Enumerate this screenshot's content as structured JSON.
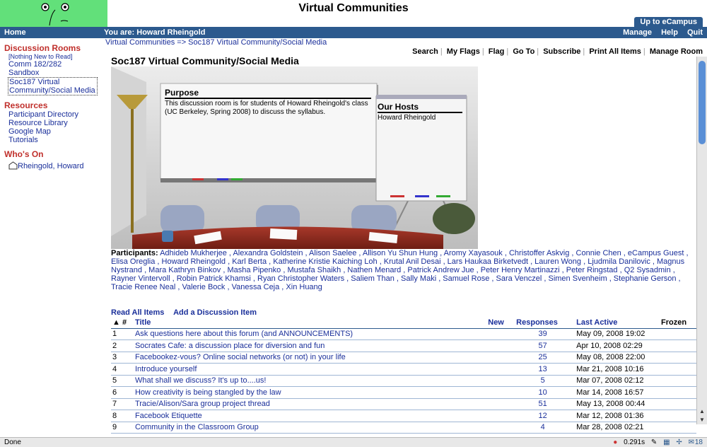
{
  "header": {
    "app_title": "Virtual Communities",
    "up_button": "Up to eCampus"
  },
  "navbar": {
    "home": "Home",
    "you_are": "You are: Howard Rheingold",
    "right": [
      "Manage",
      "Help",
      "Quit"
    ]
  },
  "sidebar": {
    "discussion_heading": "Discussion Rooms",
    "nothing_new": "[Nothing New to Read]",
    "rooms": [
      "Comm 182/282",
      "Sandbox",
      "Soc187 Virtual Community/Social Media"
    ],
    "resources_heading": "Resources",
    "resources": [
      "Participant Directory",
      "Resource Library",
      "Google Map",
      "Tutorials"
    ],
    "whos_on_heading": "Who's On",
    "whos_on": "Rheingold, Howard"
  },
  "breadcrumb": "Virtual Communities => Soc187 Virtual Community/Social Media",
  "toolbar": [
    "Search",
    "My Flags",
    "Flag",
    "Go To",
    "Subscribe",
    "Print All Items",
    "Manage Room"
  ],
  "room_title": "Soc187 Virtual Community/Social Media",
  "scene": {
    "purpose_heading": "Purpose",
    "purpose_text": "This discussion room is for students of Howard Rheingold's class (UC Berkeley, Spring 2008) to discuss the syllabus.",
    "hosts_heading": "Our Hosts",
    "hosts_text": "Howard Rheingold"
  },
  "participants": {
    "label": "Participants:",
    "names": "Adhideb Mukherjee , Alexandra Goldstein , Alison Saelee , Allison Yu Shun Hung , Aromy Xayasouk , Christoffer Askvig , Connie Chen , eCampus Guest , Elisa Oreglia , Howard Rheingold , Karl Berta , Katherine Kristie Kaiching Loh , Krutal Anil Desai , Lars Haukaa Birketvedt , Lauren Wong , Ljudmila Danilovic , Magnus Nystrand , Mara Kathryn Binkov , Masha Pipenko , Mustafa Shaikh , Nathen Menard , Patrick Andrew Jue , Peter Henry Martinazzi , Peter Ringstad , Q2 Sysadmin , Rayner Vintervoll , Robin Patrick Khamsi , Ryan Christopher Waters , Saliem Than , Sally Maki , Samuel Rose , Sara Venczel , Simen Svenheim , Stephanie Gerson , Tracie Renee Neal , Valerie Bock , Vanessa Ceja , Xin Huang"
  },
  "actions": [
    "Read All Items",
    "Add a Discussion Item"
  ],
  "table": {
    "headers": {
      "num": "#",
      "title": "Title",
      "new": "New",
      "responses": "Responses",
      "last_active": "Last Active",
      "frozen": "Frozen"
    },
    "rows": [
      {
        "num": "1",
        "title": "Ask questions here about this forum (and ANNOUNCEMENTS)",
        "new": "",
        "responses": "39",
        "last": "May 09, 2008 19:02"
      },
      {
        "num": "2",
        "title": "Socrates Cafe: a discussion place for diversion and fun",
        "new": "",
        "responses": "57",
        "last": "Apr 10, 2008 02:29"
      },
      {
        "num": "3",
        "title": "Facebookez-vous? Online social networks (or not) in your life",
        "new": "",
        "responses": "25",
        "last": "May 08, 2008 22:00"
      },
      {
        "num": "4",
        "title": "Introduce yourself",
        "new": "",
        "responses": "13",
        "last": "Mar 21, 2008 10:16"
      },
      {
        "num": "5",
        "title": "What shall we discuss? It's up to....us!",
        "new": "",
        "responses": "5",
        "last": "Mar 07, 2008 02:12"
      },
      {
        "num": "6",
        "title": "How creativity is being stangled by the law",
        "new": "",
        "responses": "10",
        "last": "Mar 14, 2008 16:57"
      },
      {
        "num": "7",
        "title": "Tracie/Alison/Sara group project thread",
        "new": "",
        "responses": "51",
        "last": "May 13, 2008 00:44"
      },
      {
        "num": "8",
        "title": "Facebook Etiquette",
        "new": "",
        "responses": "12",
        "last": "Mar 12, 2008 01:36"
      },
      {
        "num": "9",
        "title": "Community in the Classroom Group",
        "new": "",
        "responses": "4",
        "last": "Mar 28, 2008 02:21"
      }
    ]
  },
  "statusbar": {
    "text": "Done",
    "timing": "0.291s",
    "mail_count": "18"
  },
  "colors": {
    "nav_blue": "#2c5a8e",
    "link": "#1a2f9a",
    "heading_red": "#c0302c",
    "logo_green": "#62e07a"
  }
}
